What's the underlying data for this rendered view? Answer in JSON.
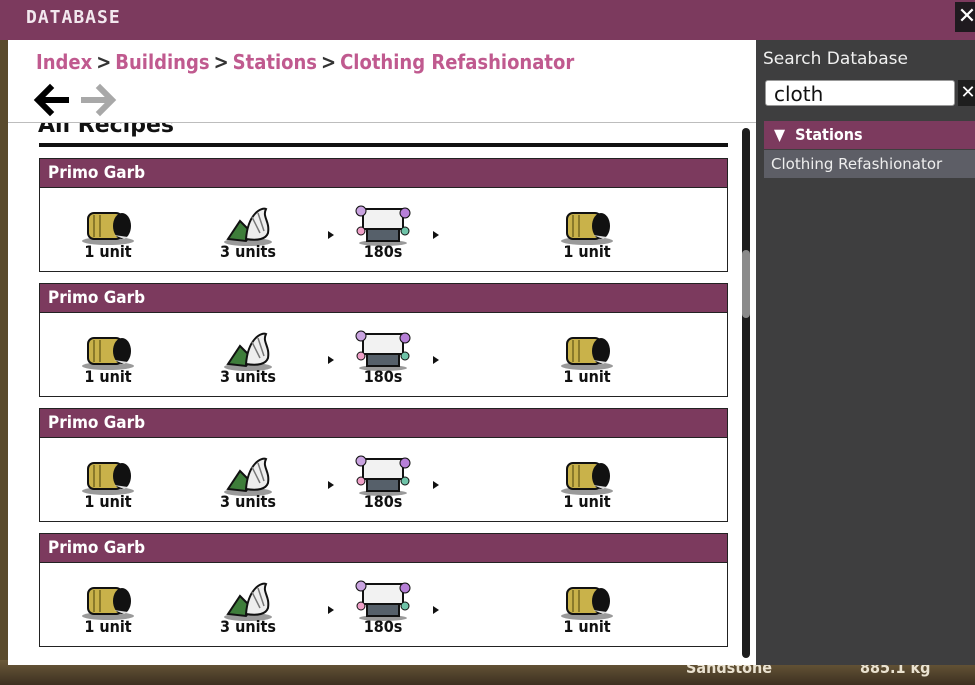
{
  "window": {
    "title": "DATABASE",
    "close_label": "✕"
  },
  "breadcrumb": [
    {
      "label": "Index"
    },
    {
      "label": "Buildings"
    },
    {
      "label": "Stations"
    },
    {
      "label": "Clothing Refashionator"
    }
  ],
  "breadcrumb_separator": ">",
  "nav": {
    "back_glyph": "🡐",
    "forward_glyph": "🡒"
  },
  "section": {
    "title": "All Recipes"
  },
  "recipes": [
    {
      "name": "Primo Garb",
      "inputs": [
        {
          "icon": "cloth-bolt-icon",
          "amount": "1 unit"
        },
        {
          "icon": "reed-fiber-icon",
          "amount": "3 units"
        }
      ],
      "time": "180s",
      "output": {
        "icon": "cloth-bolt-icon",
        "amount": "1 unit"
      }
    },
    {
      "name": "Primo Garb",
      "inputs": [
        {
          "icon": "cloth-bolt-icon",
          "amount": "1 unit"
        },
        {
          "icon": "reed-fiber-icon",
          "amount": "3 units"
        }
      ],
      "time": "180s",
      "output": {
        "icon": "cloth-bolt-icon",
        "amount": "1 unit"
      }
    },
    {
      "name": "Primo Garb",
      "inputs": [
        {
          "icon": "cloth-bolt-icon",
          "amount": "1 unit"
        },
        {
          "icon": "reed-fiber-icon",
          "amount": "3 units"
        }
      ],
      "time": "180s",
      "output": {
        "icon": "cloth-bolt-icon",
        "amount": "1 unit"
      }
    },
    {
      "name": "Primo Garb",
      "inputs": [
        {
          "icon": "cloth-bolt-icon",
          "amount": "1 unit"
        },
        {
          "icon": "reed-fiber-icon",
          "amount": "3 units"
        }
      ],
      "time": "180s",
      "output": {
        "icon": "cloth-bolt-icon",
        "amount": "1 unit"
      }
    }
  ],
  "sidebar": {
    "search_label": "Search Database",
    "search_value": "cloth",
    "clear_label": "✕",
    "category": {
      "label": "Stations",
      "expanded_glyph": "▼"
    },
    "results": [
      "Clothing Refashionator"
    ]
  },
  "background_status": {
    "left": "Sandstone",
    "right": "885.1 kg"
  },
  "colors": {
    "accent": "#7c3a5e",
    "breadcrumb": "#c05a8f",
    "panel": "#3e3e3f"
  }
}
